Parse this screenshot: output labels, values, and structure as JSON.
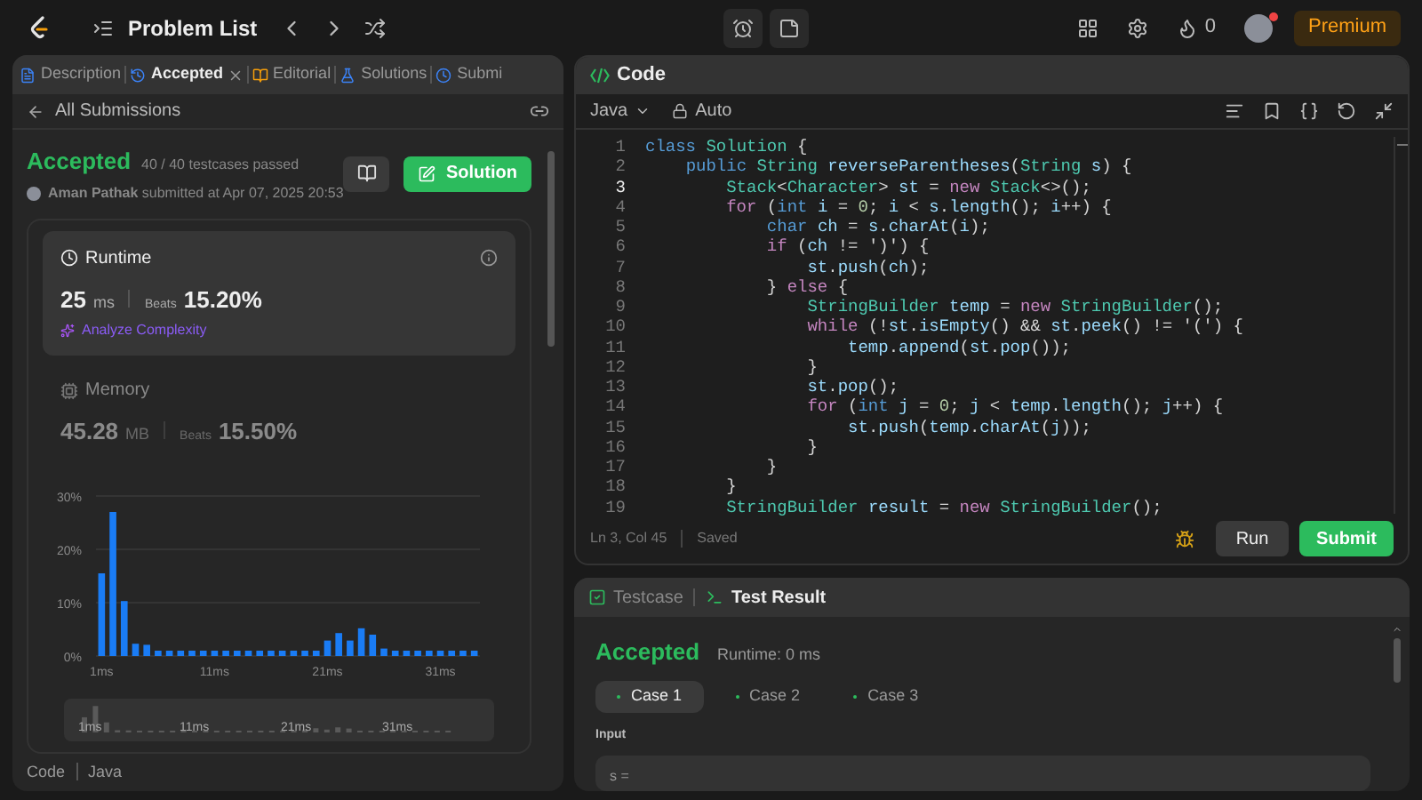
{
  "top_bar": {
    "title": "Problem List",
    "streak": "0",
    "premium": "Premium",
    "notification": true
  },
  "left_panel": {
    "tabs": [
      {
        "label": "Description",
        "selected": false,
        "closable": false
      },
      {
        "label": "Accepted",
        "selected": true,
        "closable": true
      },
      {
        "label": "Editorial",
        "selected": false,
        "closable": false
      },
      {
        "label": "Solutions",
        "selected": false,
        "closable": false
      },
      {
        "label": "Submi",
        "selected": false,
        "closable": false
      }
    ],
    "back_label": "All Submissions",
    "status": "Accepted",
    "testcases": "40 / 40 testcases passed",
    "submitted": "**Aman Pathak** submitted at Apr 07, 2025 20:53",
    "solution_button": "Solution",
    "metrics": [
      {
        "kind": "runtime",
        "title": "Runtime",
        "value": "25",
        "unit": "ms",
        "beats_label": "Beats",
        "beats": "15.20%",
        "selected": true,
        "action": "Analyze Complexity"
      },
      {
        "kind": "memory",
        "title": "Memory",
        "value": "45.28",
        "unit": "MB",
        "beats_label": "Beats",
        "beats": "15.50%",
        "selected": false
      }
    ],
    "chart_data": {
      "type": "bar",
      "x": [
        1,
        2,
        3,
        4,
        5,
        6,
        7,
        8,
        9,
        10,
        11,
        12,
        13,
        14,
        15,
        16,
        17,
        18,
        19,
        20,
        21,
        22,
        23,
        24,
        25,
        26,
        27,
        28,
        29,
        30,
        31,
        32,
        33,
        34
      ],
      "values": [
        15.5,
        27,
        10.3,
        2.3,
        2.1,
        1,
        1,
        1,
        1,
        1,
        1,
        1,
        1,
        1,
        1,
        1,
        1,
        1,
        1,
        1,
        2.9,
        4.3,
        2.9,
        5.2,
        4,
        1.4,
        1,
        1,
        1,
        1,
        1,
        1,
        1,
        1
      ],
      "xlim": [
        0.5,
        34.5
      ],
      "ylim": [
        0,
        30
      ],
      "yticks": [
        {
          "value": 0,
          "label": "0%"
        },
        {
          "value": 10,
          "label": "10%"
        },
        {
          "value": 20,
          "label": "20%"
        },
        {
          "value": 30,
          "label": "30%"
        }
      ],
      "xticks": [
        {
          "value": 1,
          "label": "1ms"
        },
        {
          "value": 11,
          "label": "11ms"
        },
        {
          "value": 21,
          "label": "21ms"
        },
        {
          "value": 31,
          "label": "31ms"
        }
      ]
    },
    "minimap_labels": [
      "1ms",
      "11ms",
      "21ms",
      "31ms"
    ],
    "code_label": "Code",
    "language": "Java"
  },
  "editor": {
    "title": "Code",
    "language": "Java",
    "mode": "Auto",
    "lines": [
      {
        "number": "1",
        "text": "class Solution {",
        "current": false
      },
      {
        "number": "2",
        "text": "    public String reverseParentheses(String s) {",
        "current": false
      },
      {
        "number": "3",
        "text": "        Stack<Character> st = new Stack<>();",
        "current": true
      },
      {
        "number": "4",
        "text": "        for (int i = 0; i < s.length(); i++) {",
        "current": false
      },
      {
        "number": "5",
        "text": "            char ch = s.charAt(i);",
        "current": false
      },
      {
        "number": "6",
        "text": "            if (ch != ')') {",
        "current": false
      },
      {
        "number": "7",
        "text": "                st.push(ch);",
        "current": false
      },
      {
        "number": "8",
        "text": "            } else {",
        "current": false
      },
      {
        "number": "9",
        "text": "                StringBuilder temp = new StringBuilder();",
        "current": false
      },
      {
        "number": "10",
        "text": "                while (!st.isEmpty() && st.peek() != '(') {",
        "current": false
      },
      {
        "number": "11",
        "text": "                    temp.append(st.pop());",
        "current": false
      },
      {
        "number": "12",
        "text": "                }",
        "current": false
      },
      {
        "number": "13",
        "text": "                st.pop();",
        "current": false
      },
      {
        "number": "14",
        "text": "                for (int j = 0; j < temp.length(); j++) {",
        "current": false
      },
      {
        "number": "15",
        "text": "                    st.push(temp.charAt(j));",
        "current": false
      },
      {
        "number": "16",
        "text": "                }",
        "current": false
      },
      {
        "number": "17",
        "text": "            }",
        "current": false
      },
      {
        "number": "18",
        "text": "        }",
        "current": false
      },
      {
        "number": "19",
        "text": "        StringBuilder result = new StringBuilder();",
        "current": false
      }
    ],
    "position": "Ln 3, Col 45",
    "saved": "Saved",
    "run": "Run",
    "submit": "Submit"
  },
  "result_panel": {
    "tabs": [
      {
        "label": "Testcase",
        "selected": false
      },
      {
        "label": "Test Result",
        "selected": true
      }
    ],
    "status": "Accepted",
    "runtime": "Runtime: 0 ms",
    "cases": [
      {
        "label": "Case 1",
        "selected": true
      },
      {
        "label": "Case 2",
        "selected": false
      },
      {
        "label": "Case 3",
        "selected": false
      }
    ],
    "input_label": "Input",
    "input_value": "s ="
  }
}
